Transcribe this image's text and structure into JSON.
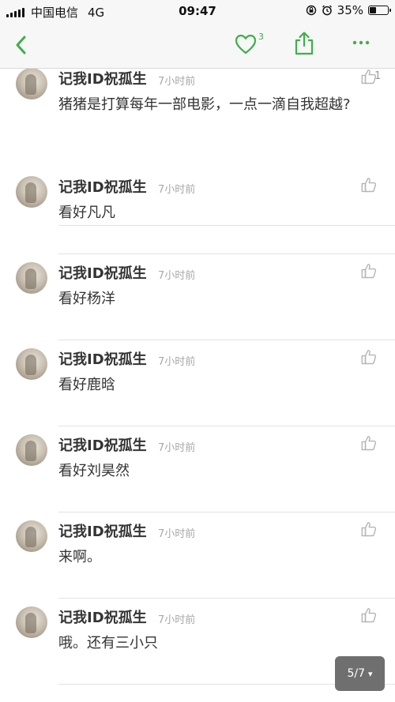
{
  "status_bar": {
    "carrier": "中国电信",
    "network": "4G",
    "time": "09:47",
    "battery": "35%",
    "battery_level": 0.35
  },
  "nav": {
    "heart_count": "3",
    "accent_color": "#3fae4b"
  },
  "comments": [
    {
      "username": "记我ID祝孤生",
      "time": "7小时前",
      "likes": "1",
      "text": "猪猪是打算每年一部电影，一点一滴自我超越?"
    },
    {
      "username": "记我ID祝孤生",
      "time": "7小时前",
      "likes": "",
      "text": "看好凡凡"
    },
    {
      "username": "记我ID祝孤生",
      "time": "7小时前",
      "likes": "",
      "text": "看好杨洋"
    },
    {
      "username": "记我ID祝孤生",
      "time": "7小时前",
      "likes": "",
      "text": "看好鹿晗"
    },
    {
      "username": "记我ID祝孤生",
      "time": "7小时前",
      "likes": "",
      "text": "看好刘昊然"
    },
    {
      "username": "记我ID祝孤生",
      "time": "7小时前",
      "likes": "",
      "text": "来啊。"
    },
    {
      "username": "记我ID祝孤生",
      "time": "7小时前",
      "likes": "",
      "text": "哦。还有三小只"
    }
  ],
  "pagination": {
    "label": "5/7",
    "caret": "▾"
  }
}
